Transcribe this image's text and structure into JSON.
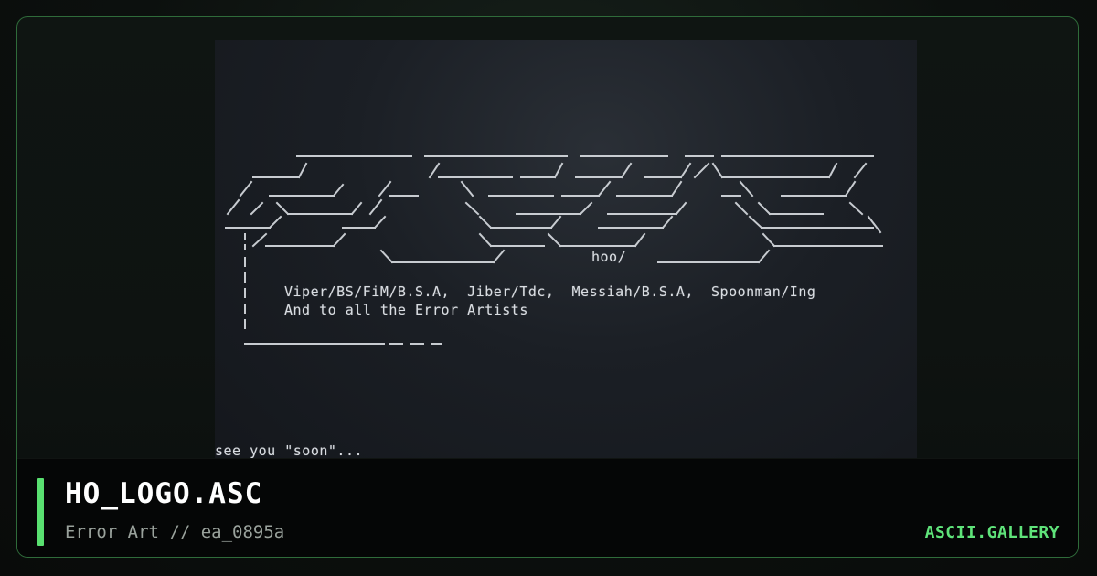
{
  "artwork": {
    "credits_line_1": "Viper/BS/FiM/B.S.A,  Jiber/Tdc,  Messiah/B.S.A,  Spoonman/Ing",
    "credits_line_2": "And to all the Error Artists",
    "tag": "hoo/",
    "trailer": "see you \"soon\"..."
  },
  "footer": {
    "title": "HO_LOGO.ASC",
    "subtitle": "Error Art // ea_0895a",
    "brand": "ASCII.GALLERY"
  },
  "colors": {
    "accent": "#59e070",
    "brand": "#5fe37a",
    "border": "#2f6b3a",
    "footer_bg": "#050606"
  }
}
